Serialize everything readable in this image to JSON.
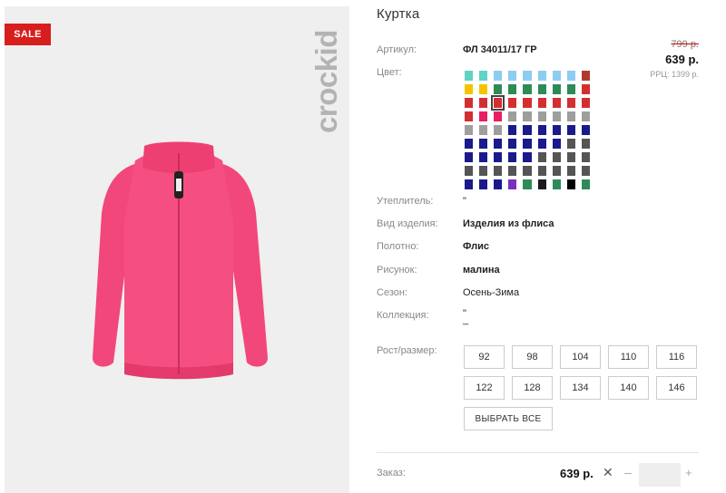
{
  "gallery": {
    "badge": "SALE",
    "brand": "crockid"
  },
  "product": {
    "title": "Куртка",
    "article_label": "Артикул:",
    "article_value": "ФЛ 34011/17 ГР",
    "color_label": "Цвет:",
    "price_old": "799 р.",
    "price_new": "639 р.",
    "rrp": "РРЦ: 1399 р."
  },
  "swatches": [
    [
      "#5fd3c4",
      "#5fd3c4",
      "#8ccdf0",
      "#8ccdf0",
      "#8ccdf0",
      "#8ccdf0",
      "#8ccdf0",
      "#8ccdf0",
      "#b03a2e"
    ],
    [
      "#f5c400",
      "#f5c400",
      "#2e8b57",
      "#2e8b57",
      "#2e8b57",
      "#2e8b57",
      "#2e8b57",
      "#2e8b57",
      "#d32f2f"
    ],
    [
      "#d32f2f",
      "#d32f2f",
      "#d32f2f",
      "#d32f2f",
      "#d32f2f",
      "#d32f2f",
      "#d32f2f",
      "#d32f2f",
      "#d32f2f"
    ],
    [
      "#d32f2f",
      "#e91e63",
      "#e91e63",
      "#9e9e9e",
      "#9e9e9e",
      "#9e9e9e",
      "#9e9e9e",
      "#9e9e9e",
      "#9e9e9e"
    ],
    [
      "#9e9e9e",
      "#9e9e9e",
      "#9e9e9e",
      "#1a1a8c",
      "#1a1a8c",
      "#1a1a8c",
      "#1a1a8c",
      "#1a1a8c",
      "#1a1a8c"
    ],
    [
      "#1a1a8c",
      "#1a1a8c",
      "#1a1a8c",
      "#1a1a8c",
      "#1a1a8c",
      "#1a1a8c",
      "#1a1a8c",
      "#555555",
      "#555555"
    ],
    [
      "#1a1a8c",
      "#1a1a8c",
      "#1a1a8c",
      "#1a1a8c",
      "#1a1a8c",
      "#555555",
      "#555555",
      "#555555",
      "#555555"
    ],
    [
      "#555555",
      "#555555",
      "#555555",
      "#555555",
      "#555555",
      "#555555",
      "#555555",
      "#555555",
      "#555555"
    ],
    [
      "#1a1a8c",
      "#1a1a8c",
      "#1a1a8c",
      "#7b2fbf",
      "#2e8b57",
      "#1a1a1a",
      "#2e8b57",
      "#000000",
      "#2e8b57"
    ]
  ],
  "attributes": {
    "insulation_label": "Утеплитель:",
    "insulation_value": "\"",
    "type_label": "Вид изделия:",
    "type_value": "Изделия из флиса",
    "fabric_label": "Полотно:",
    "fabric_value": "Флис",
    "pattern_label": "Рисунок:",
    "pattern_value": "малина",
    "season_label": "Сезон:",
    "season_value": "Осень-Зима",
    "collection_label": "Коллекция:",
    "collection_value": "\"",
    "collection_value2": "_"
  },
  "sizes": {
    "label": "Рост/размер:",
    "row1": [
      "92",
      "98",
      "104",
      "110",
      "116"
    ],
    "row2": [
      "122",
      "128",
      "134",
      "140",
      "146"
    ],
    "select_all": "ВЫБРАТЬ ВСЕ"
  },
  "order": {
    "label": "Заказ:",
    "total": "639 р.",
    "clear": "✕",
    "minus": "–",
    "quantity": "",
    "plus": "+"
  }
}
